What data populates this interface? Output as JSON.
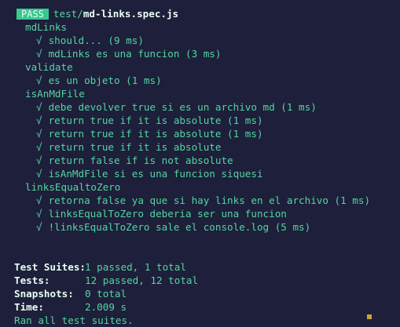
{
  "header": {
    "status": "PASS",
    "path_dir": "test/",
    "path_file": "md-links.spec.js"
  },
  "suites": [
    {
      "name": "mdLinks",
      "tests": [
        "should... (9 ms)",
        "mdLinks es una funcion (3 ms)"
      ]
    },
    {
      "name": "validate",
      "tests": [
        "es un objeto (1 ms)"
      ]
    },
    {
      "name": "isAnMdFile",
      "tests": [
        "debe devolver true si es un archivo md (1 ms)",
        "return true if it is absolute (1 ms)",
        "return true if it is absolute (1 ms)",
        "return true if it is absolute",
        "return false if is not absolute",
        "isAnMdFile si es una funcion siquesi"
      ]
    },
    {
      "name": "linksEqualtoZero",
      "tests": [
        "retorna false ya que si hay links en el archivo (1 ms)",
        "linksEqualToZero deberia ser una funcion",
        "!linksEqualToZero sale el console.log (5 ms)"
      ]
    }
  ],
  "check_glyph": "√",
  "summary": {
    "test_suites_label": "Test Suites:",
    "test_suites_value": "1 passed, 1 total",
    "tests_label": "Tests:",
    "tests_value": "12 passed, 12 total",
    "snapshots_label": "Snapshots:",
    "snapshots_value": "0 total",
    "time_label": "Time:",
    "time_value": "2.009 s",
    "footer": "Ran all test suites."
  }
}
